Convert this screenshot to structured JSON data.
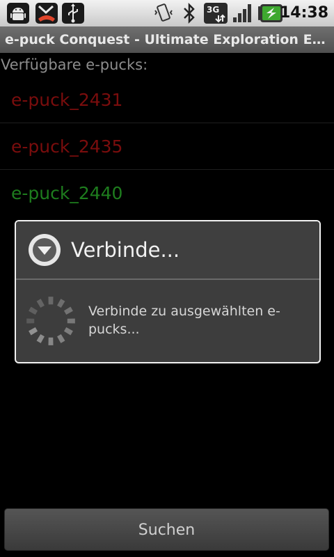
{
  "statusbar": {
    "time": "14:38",
    "icons": [
      "android-icon",
      "missed-call-icon",
      "usb-icon",
      "vibrate-icon",
      "bluetooth-icon",
      "3g-icon",
      "signal-icon",
      "battery-charging-icon"
    ],
    "network_label": "3G"
  },
  "app": {
    "title": "e-puck Conquest - Ultimate Exploration Exp..."
  },
  "list": {
    "header": "Verfügbare e-pucks:",
    "items": [
      {
        "label": "e-puck_2431",
        "color": "#7a0d0d"
      },
      {
        "label": "e-puck_2435",
        "color": "#7a0d0d"
      },
      {
        "label": "e-puck_2440",
        "color": "#1e7d1e"
      }
    ]
  },
  "dialog": {
    "title": "Verbinde...",
    "message": "Verbinde zu ausgewählten e-pucks..."
  },
  "footer": {
    "search_label": "Suchen"
  }
}
